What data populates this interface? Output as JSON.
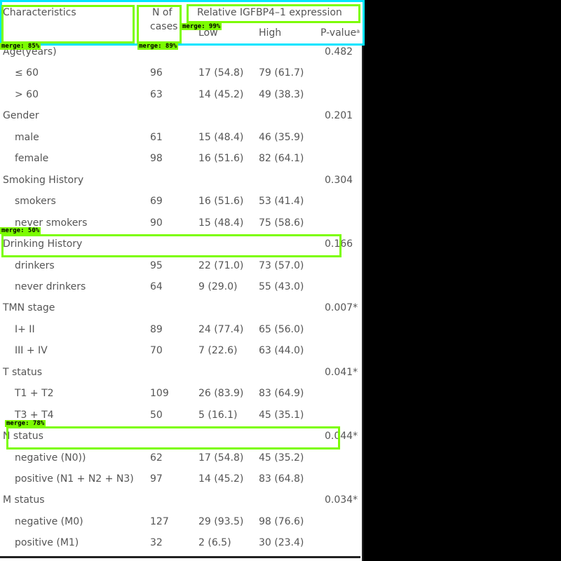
{
  "table": {
    "header": {
      "characteristics": "Characteristics",
      "n_line1": "N of",
      "n_line2": "cases",
      "relative": "Relative IGFBP4–1 expression",
      "low": "Low",
      "high": "High",
      "pvalue": "P-value",
      "pvalue_sup": "a"
    },
    "rows": [
      {
        "label": "Age(years)",
        "n": "",
        "low": "",
        "high": "",
        "p": "0.482",
        "indent": false
      },
      {
        "label": "≤ 60",
        "n": "96",
        "low": "17 (54.8)",
        "high": "79 (61.7)",
        "p": "",
        "indent": true
      },
      {
        "label": "> 60",
        "n": "63",
        "low": "14 (45.2)",
        "high": "49 (38.3)",
        "p": "",
        "indent": true
      },
      {
        "label": "Gender",
        "n": "",
        "low": "",
        "high": "",
        "p": "0.201",
        "indent": false
      },
      {
        "label": "male",
        "n": "61",
        "low": "15 (48.4)",
        "high": "46 (35.9)",
        "p": "",
        "indent": true
      },
      {
        "label": "female",
        "n": "98",
        "low": "16 (51.6)",
        "high": "82 (64.1)",
        "p": "",
        "indent": true
      },
      {
        "label": "Smoking History",
        "n": "",
        "low": "",
        "high": "",
        "p": "0.304",
        "indent": false
      },
      {
        "label": "smokers",
        "n": "69",
        "low": "16 (51.6)",
        "high": "53 (41.4)",
        "p": "",
        "indent": true
      },
      {
        "label": "never smokers",
        "n": "90",
        "low": "15 (48.4)",
        "high": "75 (58.6)",
        "p": "",
        "indent": true
      },
      {
        "label": "Drinking History",
        "n": "",
        "low": "",
        "high": "",
        "p": "0.166",
        "indent": false
      },
      {
        "label": "drinkers",
        "n": "95",
        "low": "22 (71.0)",
        "high": "73 (57.0)",
        "p": "",
        "indent": true
      },
      {
        "label": "never drinkers",
        "n": "64",
        "low": "9 (29.0)",
        "high": "55 (43.0)",
        "p": "",
        "indent": true
      },
      {
        "label": "TMN stage",
        "n": "",
        "low": "",
        "high": "",
        "p": "0.007*",
        "indent": false
      },
      {
        "label": "I+ II",
        "n": "89",
        "low": "24 (77.4)",
        "high": "65 (56.0)",
        "p": "",
        "indent": true
      },
      {
        "label": "III + IV",
        "n": "70",
        "low": "7 (22.6)",
        "high": "63 (44.0)",
        "p": "",
        "indent": true
      },
      {
        "label": "T status",
        "n": "",
        "low": "",
        "high": "",
        "p": "0.041*",
        "indent": false
      },
      {
        "label": "T1 + T2",
        "n": "109",
        "low": "26 (83.9)",
        "high": "83 (64.9)",
        "p": "",
        "indent": true
      },
      {
        "label": "T3 + T4",
        "n": "50",
        "low": "5 (16.1)",
        "high": "45 (35.1)",
        "p": "",
        "indent": true
      },
      {
        "label": "N status",
        "n": "",
        "low": "",
        "high": "",
        "p": "0.044*",
        "indent": false
      },
      {
        "label": "negative (N0))",
        "n": "62",
        "low": "17 (54.8)",
        "high": "45 (35.2)",
        "p": "",
        "indent": true
      },
      {
        "label": "positive (N1 + N2 + N3)",
        "n": "97",
        "low": "14 (45.2)",
        "high": "83 (64.8)",
        "p": "",
        "indent": true
      },
      {
        "label": "M status",
        "n": "",
        "low": "",
        "high": "",
        "p": "0.034*",
        "indent": false
      },
      {
        "label": "negative (M0)",
        "n": "127",
        "low": "29 (93.5)",
        "high": "98 (76.6)",
        "p": "",
        "indent": true
      },
      {
        "label": "positive (M1)",
        "n": "32",
        "low": "2 (6.5)",
        "high": "30 (23.4)",
        "p": "",
        "indent": true
      }
    ]
  },
  "annotations": [
    {
      "id": "characteristics",
      "tag": "merge: 85%",
      "color": "#7cfc00"
    },
    {
      "id": "n-cases",
      "tag": "merge: 89%",
      "color": "#7cfc00"
    },
    {
      "id": "relative",
      "tag": "merge: 99%",
      "color": "#7cfc00"
    },
    {
      "id": "header-row",
      "tag": "",
      "color": "#00e5ff"
    },
    {
      "id": "drinking",
      "tag": "merge: 50%",
      "color": "#7cfc00"
    },
    {
      "id": "n-status",
      "tag": "merge: 78%",
      "color": "#7cfc00"
    }
  ]
}
